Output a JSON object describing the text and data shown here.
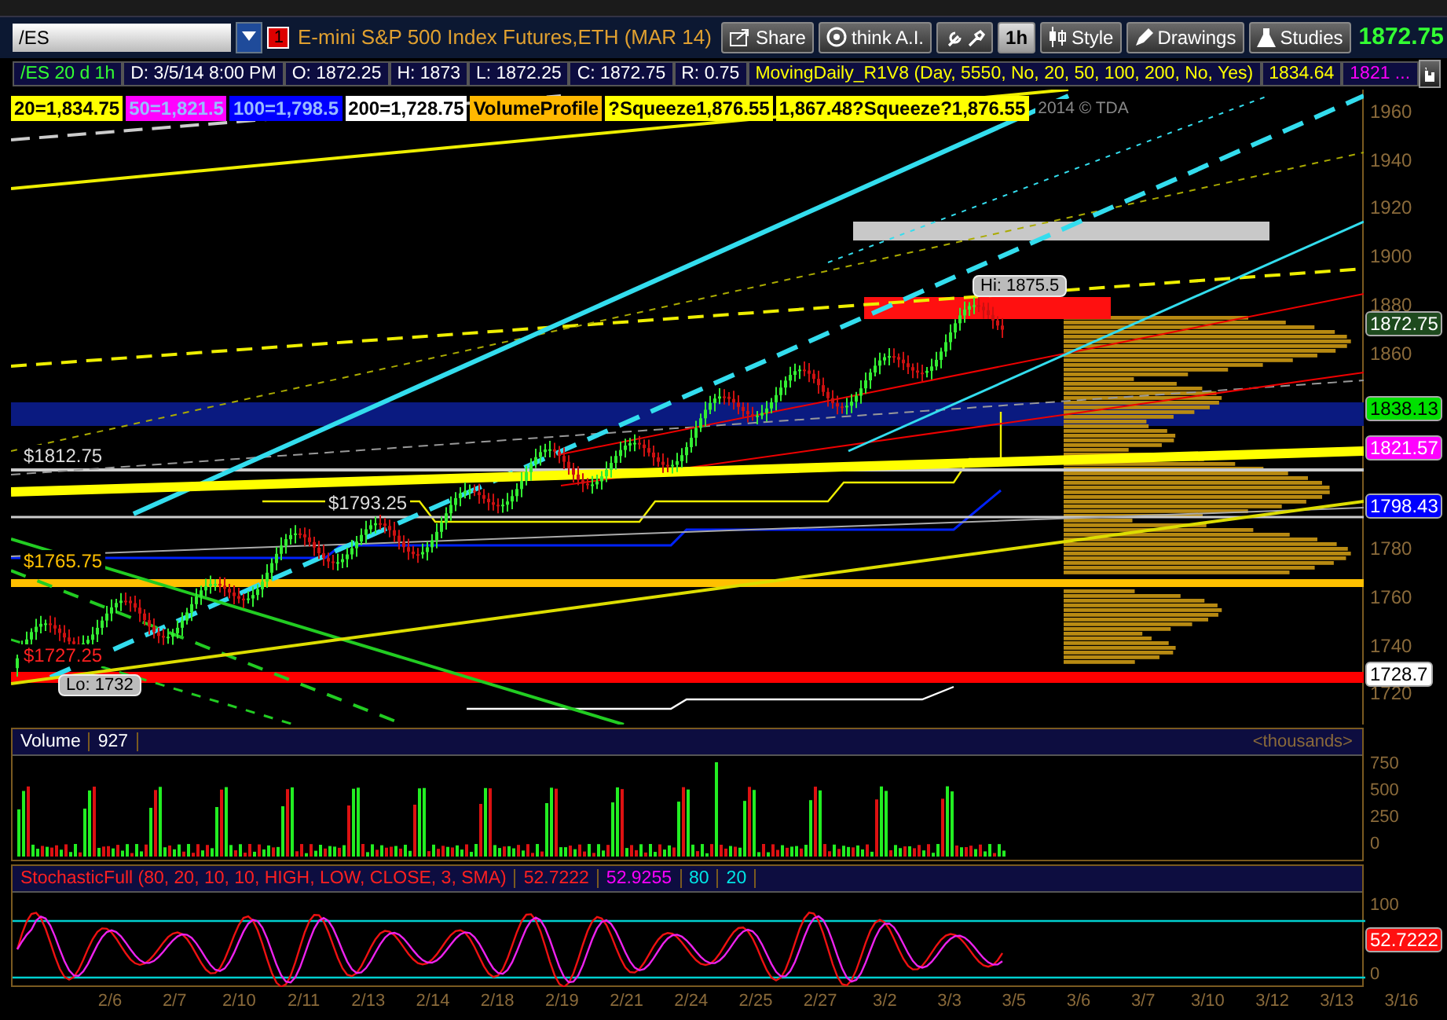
{
  "header": {
    "symbol": "/ES",
    "alert_count": "1",
    "title": "E-mini S&P 500 Index Futures,ETH (MAR 14)",
    "buttons": [
      {
        "label": "Share",
        "kind": "share"
      },
      {
        "label": "think A.I.",
        "kind": "think"
      },
      {
        "kind": "tools"
      },
      {
        "label": "1h",
        "kind": "period"
      },
      {
        "label": "Style",
        "kind": "style"
      },
      {
        "label": "Drawings",
        "kind": "drawings"
      },
      {
        "label": "Studies",
        "kind": "studies"
      }
    ],
    "last_price": "1872.75"
  },
  "info_row": [
    {
      "text": "/ES 20 d 1h",
      "kind": "symbol"
    },
    {
      "text": "D: 3/5/14 8:00 PM",
      "kind": "quote"
    },
    {
      "text": "O: 1872.25",
      "kind": "quote"
    },
    {
      "text": "H: 1873",
      "kind": "quote"
    },
    {
      "text": "L: 1872.25",
      "kind": "quote"
    },
    {
      "text": "C: 1872.75",
      "kind": "quote"
    },
    {
      "text": "R: 0.75",
      "kind": "quote"
    },
    {
      "text": "MovingDaily_R1V8 (Day, 5550, No, 20, 50, 100, 200, No, Yes)",
      "kind": "study"
    },
    {
      "text": "1834.64",
      "kind": "study"
    },
    {
      "text": "1821 ...",
      "kind": "average"
    }
  ],
  "study_chips": [
    {
      "text": "20=1,834.75",
      "color": "#ffff00"
    },
    {
      "text": "50=1,821.5",
      "color": "#ff00ff"
    },
    {
      "text": "100=1,798.5",
      "color": "#0000ff"
    },
    {
      "text": "200=1,728.75",
      "color": "#ffffff"
    },
    {
      "text": "VolumeProfile",
      "color": "#ffb800"
    },
    {
      "text": "?Squeeze1,876.55",
      "color": "#ffff00"
    },
    {
      "text": "1,867.48?Squeeze?1,876.55",
      "color": "#ffff00"
    }
  ],
  "copyright": "2014 © TDA",
  "chart_labels": [
    {
      "text": "Hi: 1875.5",
      "kind": "bubble"
    },
    {
      "text": "$1812.75",
      "kind": "price",
      "color": "#dddddd"
    },
    {
      "text": "$1793.25",
      "kind": "price",
      "color": "#dddddd"
    },
    {
      "text": "$1765.75",
      "kind": "price",
      "color": "#ffc000"
    },
    {
      "text": "$1727.25",
      "kind": "price",
      "color": "#ff2020"
    },
    {
      "text": "Lo: 1732",
      "kind": "bubble"
    }
  ],
  "price_axis": [
    "1960",
    "1940",
    "1920",
    "1900",
    "1880",
    "1860",
    "1780",
    "1760",
    "1740",
    "1720"
  ],
  "price_badges": [
    {
      "text": "1872.75",
      "color": "#1e4a1e"
    },
    {
      "text": "1838.13",
      "color": "#00e000"
    },
    {
      "text": "1821.57",
      "color": "#ff00ff"
    },
    {
      "text": "1798.43",
      "color": "#0000ff"
    },
    {
      "text": "1728.7",
      "color": "#ffffff"
    }
  ],
  "volume": {
    "title": "Volume",
    "value": "927",
    "units": "<thousands>",
    "axis": [
      "750",
      "500",
      "250",
      "0"
    ]
  },
  "stochastic": {
    "title": "StochasticFull (80, 20, 10, 10, HIGH, LOW, CLOSE, 3, SMA)",
    "values": [
      {
        "text": "52.7222",
        "color": "#ff2020"
      },
      {
        "text": "52.9255",
        "color": "#ff00ff"
      },
      {
        "text": "80",
        "color": "#00e5e5"
      },
      {
        "text": "20",
        "color": "#00e5e5"
      }
    ],
    "axis": [
      "100",
      "0"
    ],
    "badge": "52.7222"
  },
  "dates": [
    "2/6",
    "2/7",
    "2/10",
    "2/11",
    "2/13",
    "2/14",
    "2/18",
    "2/19",
    "2/21",
    "2/24",
    "2/25",
    "2/27",
    "3/2",
    "3/3",
    "3/5",
    "3/6",
    "3/7",
    "3/10",
    "3/12",
    "3/13",
    "3/16"
  ]
}
